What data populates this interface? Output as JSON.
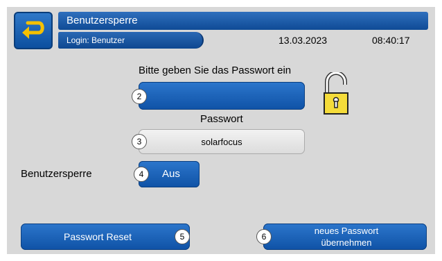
{
  "header": {
    "title": "Benutzersperre",
    "login": "Login: Benutzer",
    "date": "13.03.2023",
    "time": "08:40:17",
    "back_icon": "back-arrow-icon"
  },
  "main": {
    "prompt": "Bitte geben Sie das Passwort ein",
    "password_label": "Passwort",
    "password_value": "solarfocus",
    "lock_label": "Benutzersperre",
    "lock_toggle": "Aus",
    "lock_icon": "unlocked-padlock-icon",
    "badges": [
      "2",
      "3",
      "4",
      "5",
      "6"
    ]
  },
  "footer": {
    "reset_label": "Passwort Reset",
    "apply_label": "neues Passwort übernehmen"
  },
  "colors": {
    "button_blue": "#1a5fb4",
    "background": "#d8d8d8",
    "lock_yellow": "#f5dc3a"
  }
}
